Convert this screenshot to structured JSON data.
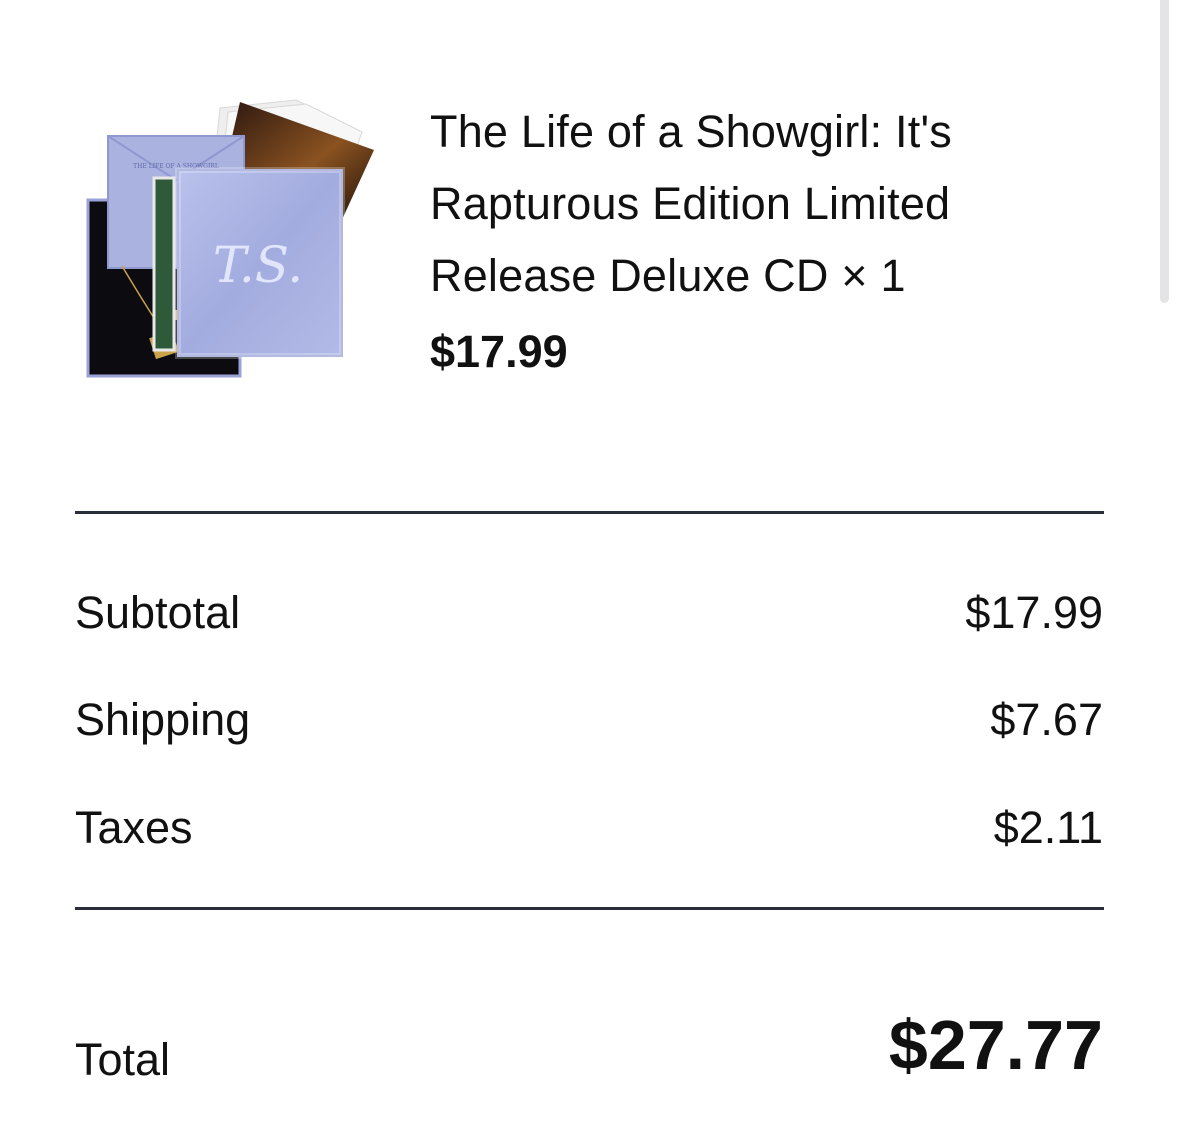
{
  "product": {
    "image_alt": "T.S. deluxe CD box set",
    "image_monogram": "T.S.",
    "title_line1": "The Life of a Showgirl: It's",
    "title_line2": "Rapturous Edition Limited",
    "title_line3": "Release Deluxe CD × 1",
    "price": "$17.99"
  },
  "summary": {
    "subtotal_label": "Subtotal",
    "subtotal_value": "$17.99",
    "shipping_label": "Shipping",
    "shipping_value": "$7.67",
    "taxes_label": "Taxes",
    "taxes_value": "$2.11",
    "total_label": "Total",
    "total_value": "$27.77"
  },
  "colors": {
    "divider": "#2a2e38",
    "box_lavender": "#a8b0de",
    "text": "#111111"
  }
}
